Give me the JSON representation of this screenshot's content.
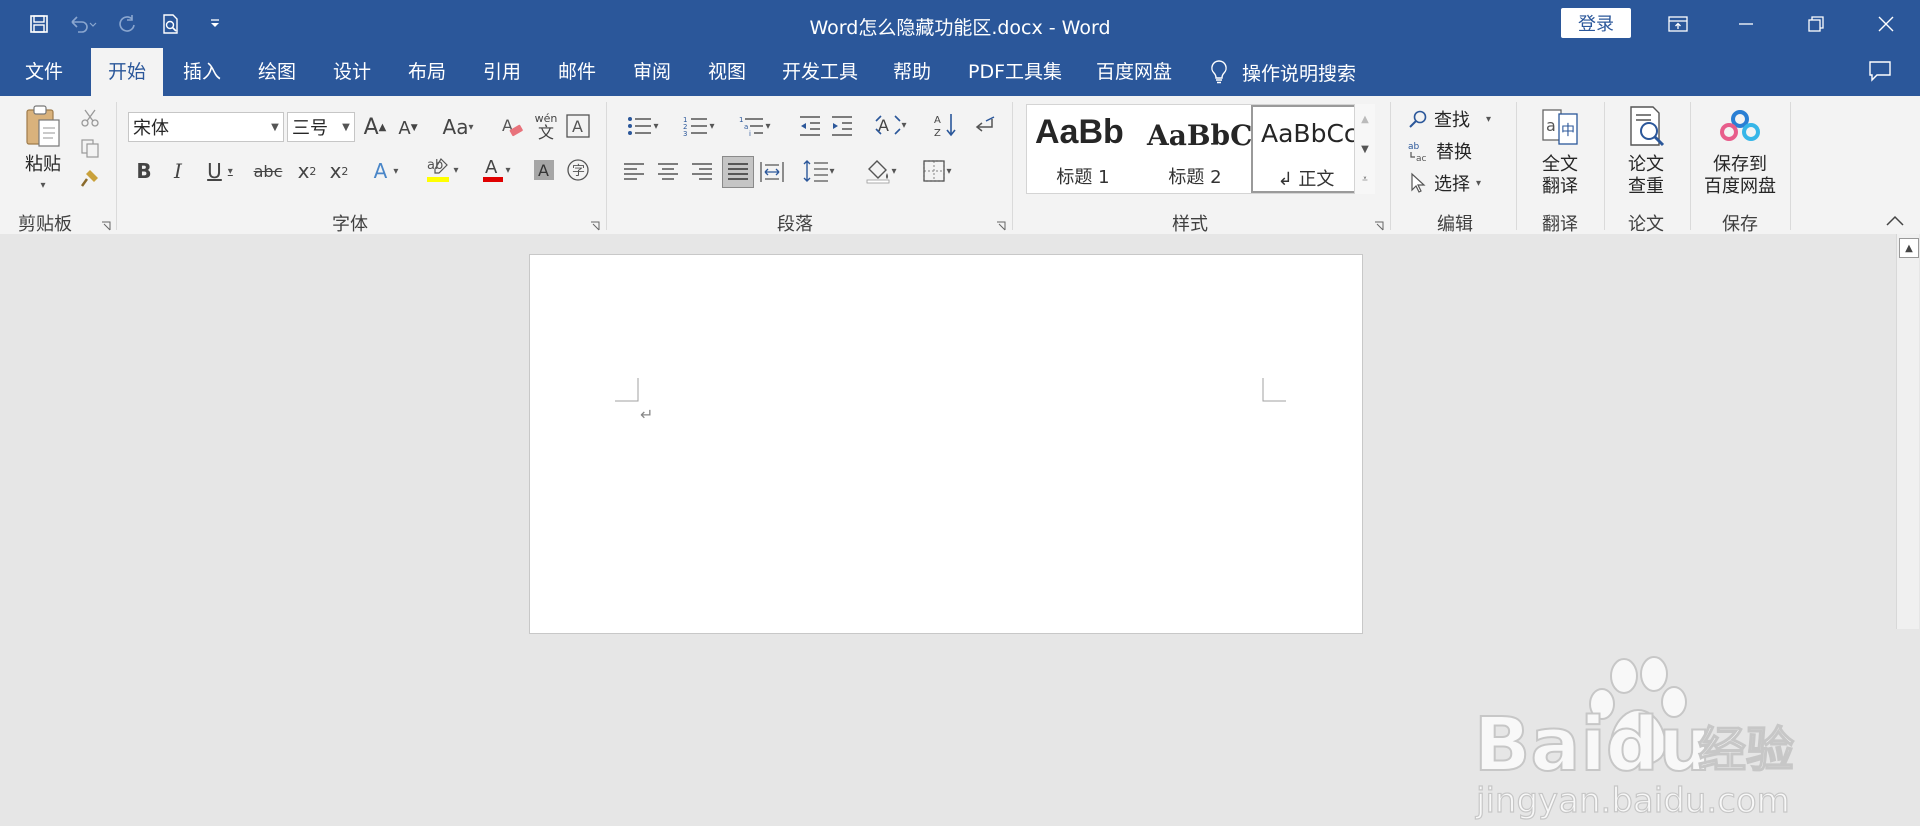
{
  "window": {
    "title": "Word怎么隐藏功能区.docx  -  Word",
    "login_label": "登录",
    "accent_color": "#2b579a"
  },
  "quick_access": [
    "save-icon",
    "undo-icon",
    "redo-icon",
    "print-preview-icon",
    "customize-qat-icon"
  ],
  "tabs": [
    {
      "label": "文件"
    },
    {
      "label": "开始"
    },
    {
      "label": "插入"
    },
    {
      "label": "绘图"
    },
    {
      "label": "设计"
    },
    {
      "label": "布局"
    },
    {
      "label": "引用"
    },
    {
      "label": "邮件"
    },
    {
      "label": "审阅"
    },
    {
      "label": "视图"
    },
    {
      "label": "开发工具"
    },
    {
      "label": "帮助"
    },
    {
      "label": "PDF工具集"
    },
    {
      "label": "百度网盘"
    }
  ],
  "active_tab": "开始",
  "tell_me": "操作说明搜索",
  "ribbon": {
    "clipboard": {
      "label": "剪贴板",
      "paste": "粘贴"
    },
    "font": {
      "label": "字体",
      "font_name": "宋体",
      "font_size": "三号",
      "case_label": "Aa",
      "grow": "A",
      "shrink": "A",
      "phonetic_top": "wén",
      "phonetic_bottom": "文"
    },
    "paragraph": {
      "label": "段落"
    },
    "styles": {
      "label": "样式",
      "items": [
        {
          "preview": "AaBb",
          "name": "标题 1"
        },
        {
          "preview": "AaBbC",
          "name": "标题 2"
        },
        {
          "preview": "AaBbCc",
          "name": "↲ 正文"
        }
      ]
    },
    "editing": {
      "label": "编辑",
      "find": "查找",
      "replace": "替换",
      "select": "选择"
    },
    "translate": {
      "label": "翻译",
      "button_line1": "全文",
      "button_line2": "翻译"
    },
    "paper": {
      "label": "论文",
      "button_line1": "论文",
      "button_line2": "查重"
    },
    "save": {
      "label": "保存",
      "button_line1": "保存到",
      "button_line2": "百度网盘"
    }
  },
  "document": {
    "paragraph_mark": "↵"
  },
  "watermark": {
    "brand": "Baidu",
    "brand_cn": "经验",
    "url": "jingyan.baidu.com"
  }
}
